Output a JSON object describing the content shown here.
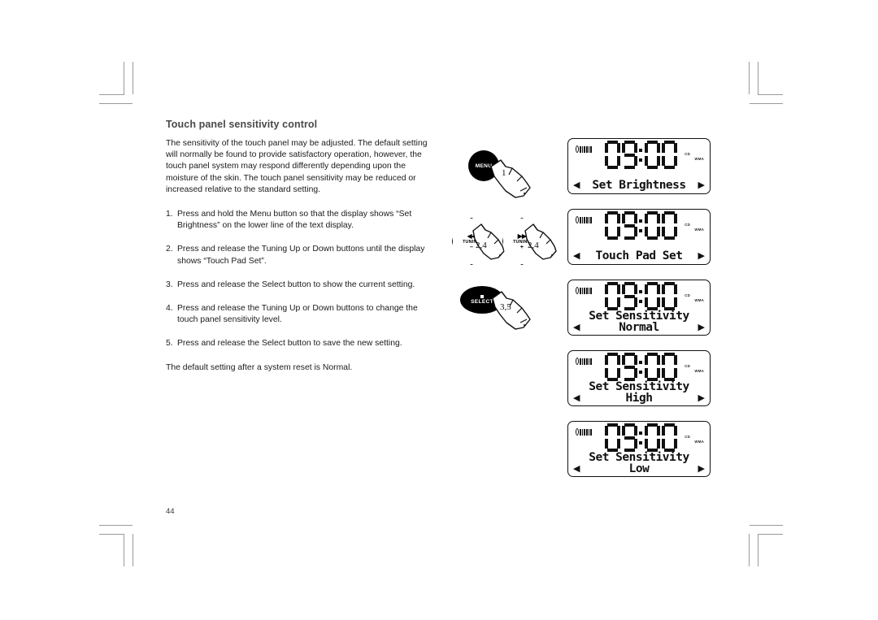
{
  "page": {
    "number": "44",
    "title": "Touch panel sensitivity control",
    "intro": "The sensitivity of the touch panel may be adjusted. The default setting will normally be found to provide satisfactory operation, however, the touch panel system may respond differently depending upon the moisture of the skin. The touch panel sensitivity may be reduced or increased relative to the standard setting.",
    "closing_note": "The default setting after a system reset is Normal."
  },
  "steps": [
    {
      "num": "1.",
      "text": "Press and hold the Menu button so that the display shows “Set Brightness” on the lower line of the text display."
    },
    {
      "num": "2.",
      "text": "Press and release the Tuning Up or Down buttons until the display shows “Touch Pad Set”."
    },
    {
      "num": "3.",
      "text": "Press and release the Select button to show the current setting."
    },
    {
      "num": "4.",
      "text": "Press and release the Tuning Up or Down buttons to change the touch panel sensitivity level."
    },
    {
      "num": "5.",
      "text": "Press and release the Select button to save the new setting."
    }
  ],
  "controls": {
    "menu": {
      "label": "MENU",
      "step": "1"
    },
    "tuning_down": {
      "glyph": "◀◀",
      "label": "TUNING",
      "sign": "–",
      "step": "2,4"
    },
    "tuning_up": {
      "glyph": "▶▶",
      "label": "TUNING",
      "sign": "+",
      "step": "2,4"
    },
    "select": {
      "label": "SELECT",
      "step": "3,5"
    }
  },
  "lcd": {
    "time": "09:00",
    "format_cd": "CD",
    "format_wma": "WMA",
    "arrow_left": "◀",
    "arrow_right": "▶",
    "panels": [
      {
        "line1": "Set Brightness",
        "line2": "",
        "arrows": "line1"
      },
      {
        "line1": "Touch Pad Set",
        "line2": "",
        "arrows": "line1"
      },
      {
        "line1": "Set Sensitivity",
        "line2": "Normal",
        "arrows": "line2"
      },
      {
        "line1": "Set Sensitivity",
        "line2": "High",
        "arrows": "line2"
      },
      {
        "line1": "Set Sensitivity",
        "line2": "Low",
        "arrows": "line2"
      }
    ]
  }
}
